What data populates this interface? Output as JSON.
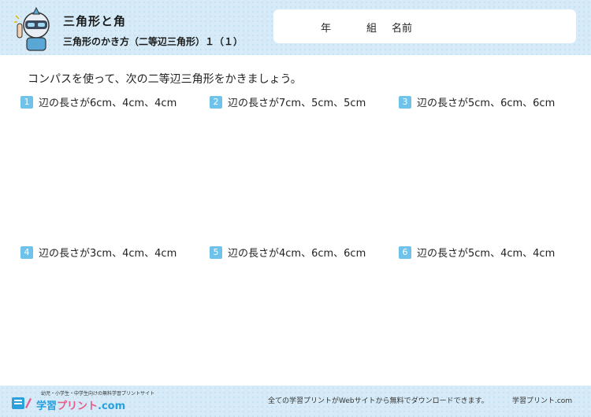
{
  "header": {
    "title": "三角形と角",
    "subtitle": "三角形のかき方（二等辺三角形）１（１）"
  },
  "name_box": {
    "year_label": "年",
    "class_label": "組",
    "name_label": "名前"
  },
  "instruction": "コンパスを使って、次の二等辺三角形をかきましょう。",
  "problems": [
    {
      "number": "1",
      "text": "辺の長さが6cm、4cm、4cm"
    },
    {
      "number": "2",
      "text": "辺の長さが7cm、5cm、5cm"
    },
    {
      "number": "3",
      "text": "辺の長さが5cm、6cm、6cm"
    },
    {
      "number": "4",
      "text": "辺の長さが3cm、4cm、4cm"
    },
    {
      "number": "5",
      "text": "辺の長さが4cm、6cm、6cm"
    },
    {
      "number": "6",
      "text": "辺の長さが5cm、4cm、4cm"
    }
  ],
  "footer": {
    "logo_tagline": "幼児・小学生・中学生向けの無料学習プリントサイト",
    "logo_text_main": "学習",
    "logo_text_accent": "プリント",
    "logo_text_suffix": ".com",
    "note": "全ての学習プリントがWebサイトから無料でダウンロードできます。",
    "brand": "学習プリント.com"
  },
  "colors": {
    "header_bg": "#d6ebf7",
    "number_badge": "#6fc3ea",
    "logo_blue": "#2aa0dc",
    "logo_pink": "#e85a8a"
  },
  "icons": {
    "mascot": "robot-mascot-icon",
    "logo": "pencil-notebook-icon"
  }
}
